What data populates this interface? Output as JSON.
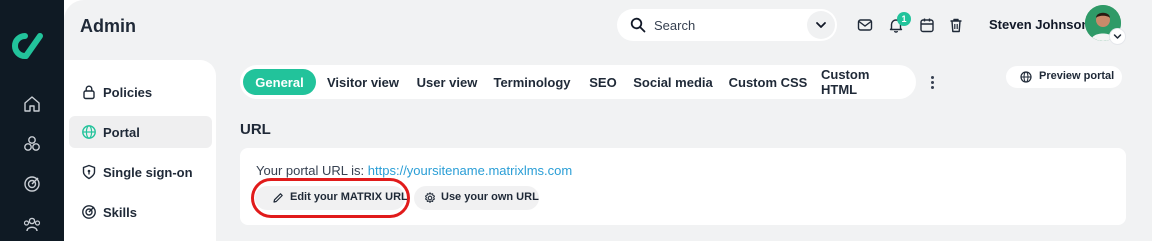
{
  "app": {
    "page_title": "Admin",
    "brand_color": "#22c39b",
    "rail_color": "#0f1a24",
    "rail_icons": [
      "home-icon",
      "courses-icon",
      "target-icon",
      "users-icon"
    ]
  },
  "header": {
    "search_placeholder": "Search",
    "notification_count": "1",
    "user_name": "Steven Johnson",
    "icons": [
      "mail-icon",
      "bell-icon",
      "calendar-icon",
      "trash-icon"
    ]
  },
  "sidebar": {
    "items": [
      {
        "label": "Policies",
        "icon": "lock-icon",
        "active": false
      },
      {
        "label": "Portal",
        "icon": "globe-icon",
        "active": true
      },
      {
        "label": "Single sign-on",
        "icon": "shield-icon",
        "active": false
      },
      {
        "label": "Skills",
        "icon": "target-icon",
        "active": false
      }
    ]
  },
  "tabs": {
    "items": [
      {
        "label": "General",
        "active": true
      },
      {
        "label": "Visitor view",
        "active": false
      },
      {
        "label": "User view",
        "active": false
      },
      {
        "label": "Terminology",
        "active": false
      },
      {
        "label": "SEO",
        "active": false
      },
      {
        "label": "Social media",
        "active": false
      },
      {
        "label": "Custom CSS",
        "active": false
      },
      {
        "label": "Custom HTML",
        "active": false
      }
    ],
    "more_icon": "kebab-icon",
    "preview_label": "Preview portal"
  },
  "url_section": {
    "title": "URL",
    "portal_url_prefix": "Your portal URL is:",
    "portal_url": "https://yoursitename.matrixlms.com",
    "edit_button": "Edit your MATRIX URL",
    "own_url_button": "Use your own URL",
    "highlight_color": "#e11b1b"
  }
}
